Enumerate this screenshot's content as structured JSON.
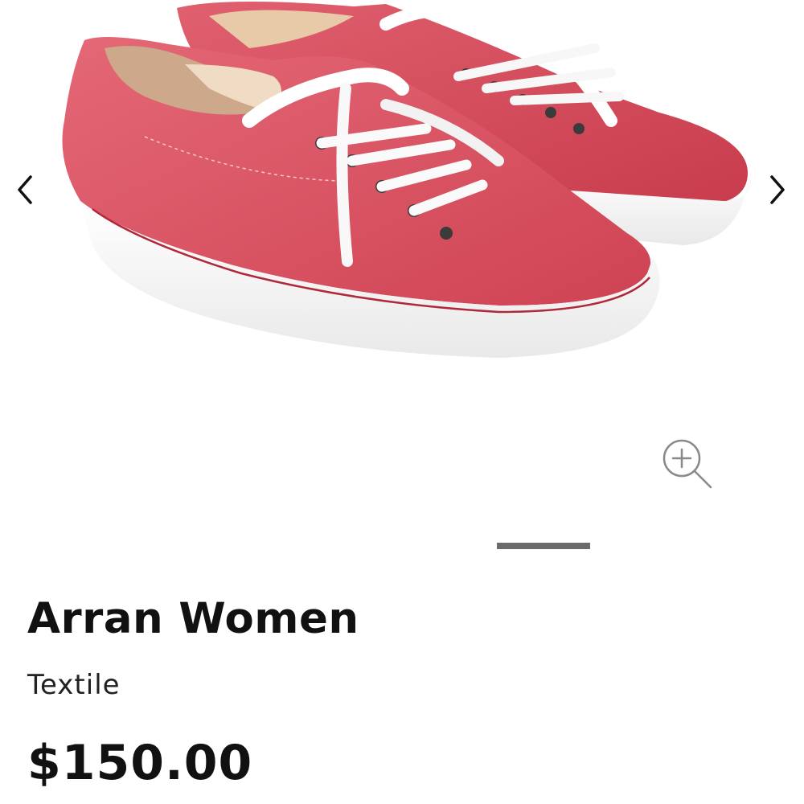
{
  "gallery": {
    "prev_icon": "chevron-left-icon",
    "next_icon": "chevron-right-icon",
    "zoom_icon": "zoom-in-icon",
    "slide_count_visible": 1,
    "shoe_color": "#d9505e",
    "sole_color": "#ffffff"
  },
  "product": {
    "name": "Arran Women",
    "material": "Textile",
    "price": "$150.00"
  }
}
